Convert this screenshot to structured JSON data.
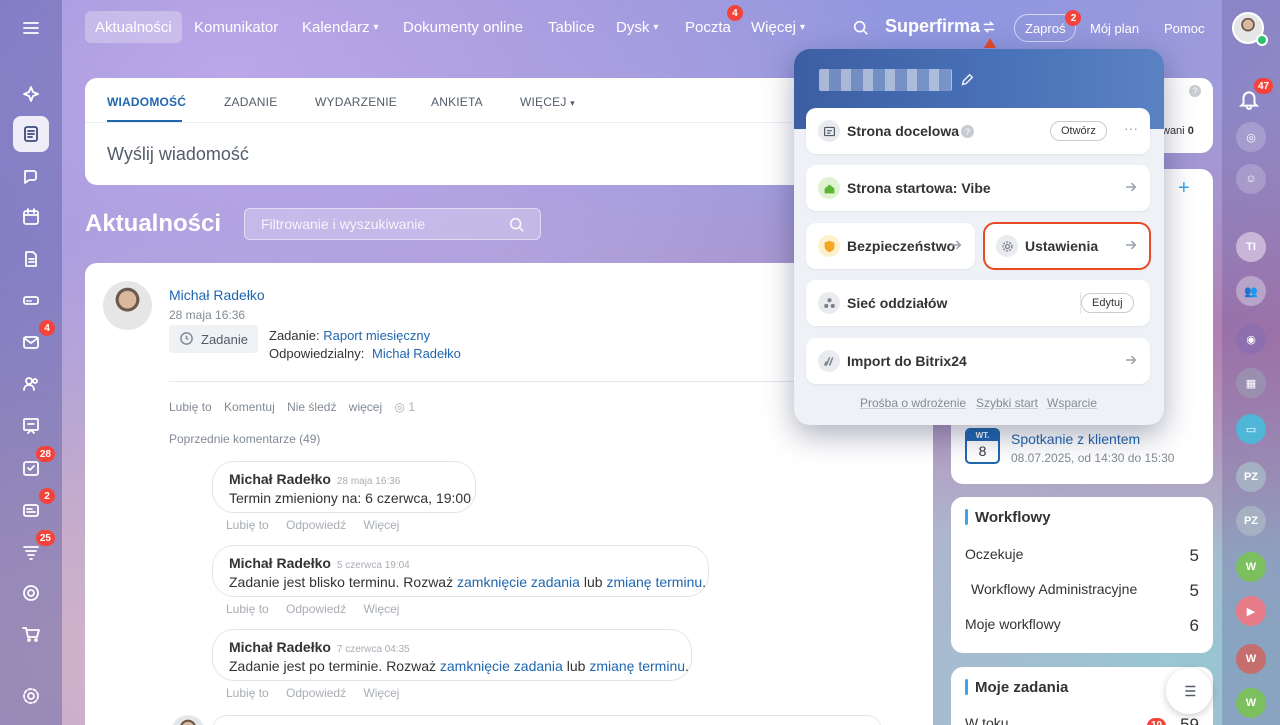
{
  "nav": {
    "items": [
      {
        "label": "Aktualności"
      },
      {
        "label": "Komunikator"
      },
      {
        "label": "Kalendarz",
        "chevron": "▾"
      },
      {
        "label": "Dokumenty online"
      },
      {
        "label": "Tablice"
      },
      {
        "label": "Dysk",
        "chevron": "▾"
      },
      {
        "label": "Poczta",
        "badge": "4"
      },
      {
        "label": "Więcej",
        "chevron": "▾"
      }
    ],
    "brand": "Superfirma",
    "invite_label": "Zaproś",
    "invite_badge": "2",
    "my_plan_label": "Mój plan",
    "help_label": "Pomoc"
  },
  "left_sidebar": {
    "badges": {
      "mail": "4",
      "tasks": "28",
      "crm": "2",
      "flows": "25"
    }
  },
  "composer": {
    "tabs": [
      "WIADOMOŚĆ",
      "ZADANIE",
      "WYDARZENIE",
      "ANKIETA",
      "WIĘCEJ"
    ],
    "more_chevron": "▾",
    "placeholder": "Wyślij wiadomość"
  },
  "feed": {
    "title": "Aktualności",
    "filter_placeholder": "Filtrowanie i wyszukiwanie",
    "post": {
      "author": "Michał Radełko",
      "date": "28 maja 16:36",
      "type_button": "Zadanie",
      "task_prefix": "Zadanie:",
      "task_name": "Raport miesięczny",
      "responsible_label": "Odpowiedzialny:",
      "responsible": "Michał Radełko",
      "actions": [
        "Lubię to",
        "Komentuj",
        "Nie śledź",
        "więcej"
      ],
      "views": "1",
      "prev_comments": "Poprzednie komentarze (49)"
    },
    "comments": [
      {
        "author": "Michał Radełko",
        "time": "28 maja 16:36",
        "text": "Termin zmieniony na: 6 czerwca, 19:00",
        "text_pre": "",
        "link1": "",
        "mid": "",
        "link2": "",
        "end": ""
      },
      {
        "author": "Michał Radełko",
        "time": "5 czerwca 19:04",
        "text_pre": "Zadanie jest blisko terminu. Rozważ ",
        "link1": "zamknięcie zadania",
        "mid": " lub ",
        "link2": "zmianę terminu",
        "end": "."
      },
      {
        "author": "Michał Radełko",
        "time": "7 czerwca 04:35",
        "text_pre": "Zadanie jest po terminie. Rozważ ",
        "link1": "zamknięcie zadania",
        "mid": " lub ",
        "link2": "zmianę terminu",
        "end": "."
      }
    ],
    "comment_actions": [
      "Lubię to",
      "Odpowiedź",
      "Więcej"
    ]
  },
  "popup": {
    "rows": {
      "landing": {
        "label": "Strona docelowa",
        "button": "Otwórz",
        "more": "···"
      },
      "start": {
        "label": "Strona startowa: Vibe"
      },
      "security": {
        "label": "Bezpieczeństwo"
      },
      "settings": {
        "label": "Ustawienia"
      },
      "network": {
        "label": "Sieć oddziałów",
        "button": "Edytuj"
      },
      "import": {
        "label": "Import do Bitrix24"
      }
    },
    "footer": [
      "Prośba o wdrożenie",
      "Szybki start",
      "Wsparcie"
    ]
  },
  "widgets": {
    "top_partial": {
      "text": "wani",
      "count": "0"
    },
    "event": {
      "day_label": "WT.",
      "day": "8",
      "title": "Spotkanie z klientem",
      "time": "08.07.2025, od 14:30 do 15:30"
    },
    "workflows": {
      "title": "Workflowy",
      "rows": [
        {
          "label": "Oczekuje",
          "value": "5"
        },
        {
          "label": "Workflowy Administracyjne",
          "value": "5"
        },
        {
          "label": "Moje workflowy",
          "value": "6"
        }
      ]
    },
    "tasks": {
      "title": "Moje zadania",
      "row_label": "W toku",
      "row_badge": "10",
      "row_value": "59"
    }
  },
  "right_sidebar": {
    "notif_badge": "47",
    "avatars": [
      "TI",
      "PZ",
      "PZ",
      "W",
      "W",
      "W"
    ]
  },
  "colors": {
    "accent": "#2067b0",
    "badge": "#f4433b",
    "highlight": "#e84a23"
  }
}
